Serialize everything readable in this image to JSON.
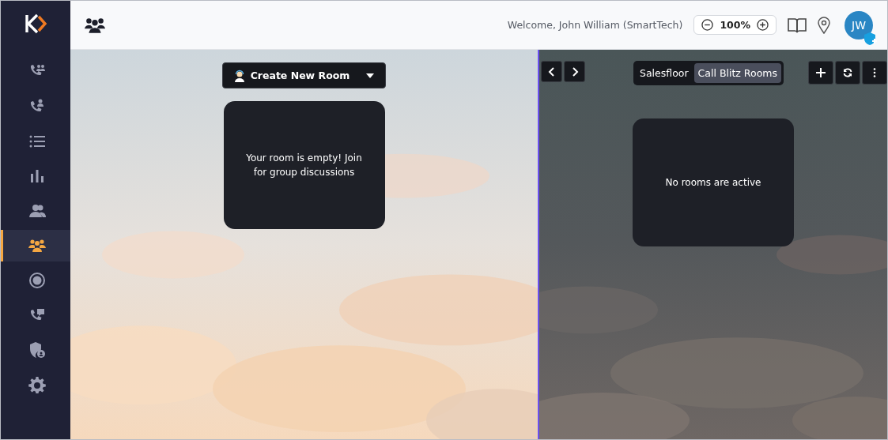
{
  "sidebar": {
    "items": [
      {
        "kind": "phone-group",
        "selected": false
      },
      {
        "kind": "phone-user",
        "selected": false
      },
      {
        "kind": "list",
        "selected": false
      },
      {
        "kind": "chart",
        "selected": false
      },
      {
        "kind": "users",
        "selected": false
      },
      {
        "kind": "group",
        "selected": true
      },
      {
        "kind": "record",
        "selected": false
      },
      {
        "kind": "phone-chat",
        "selected": false
      },
      {
        "kind": "shield",
        "selected": false
      },
      {
        "kind": "gear",
        "selected": false
      }
    ]
  },
  "header": {
    "welcome": "Welcome, John William (SmartTech)",
    "zoom": "100%",
    "avatar": "JW"
  },
  "left_pane": {
    "create_button": "Create New Room",
    "message": "Your room is empty! Join for group discussions"
  },
  "right_pane": {
    "tabs": [
      {
        "label": "Salesfloor",
        "selected": false
      },
      {
        "label": "Call Blitz Rooms",
        "selected": true
      }
    ],
    "message": "No rooms are active"
  }
}
